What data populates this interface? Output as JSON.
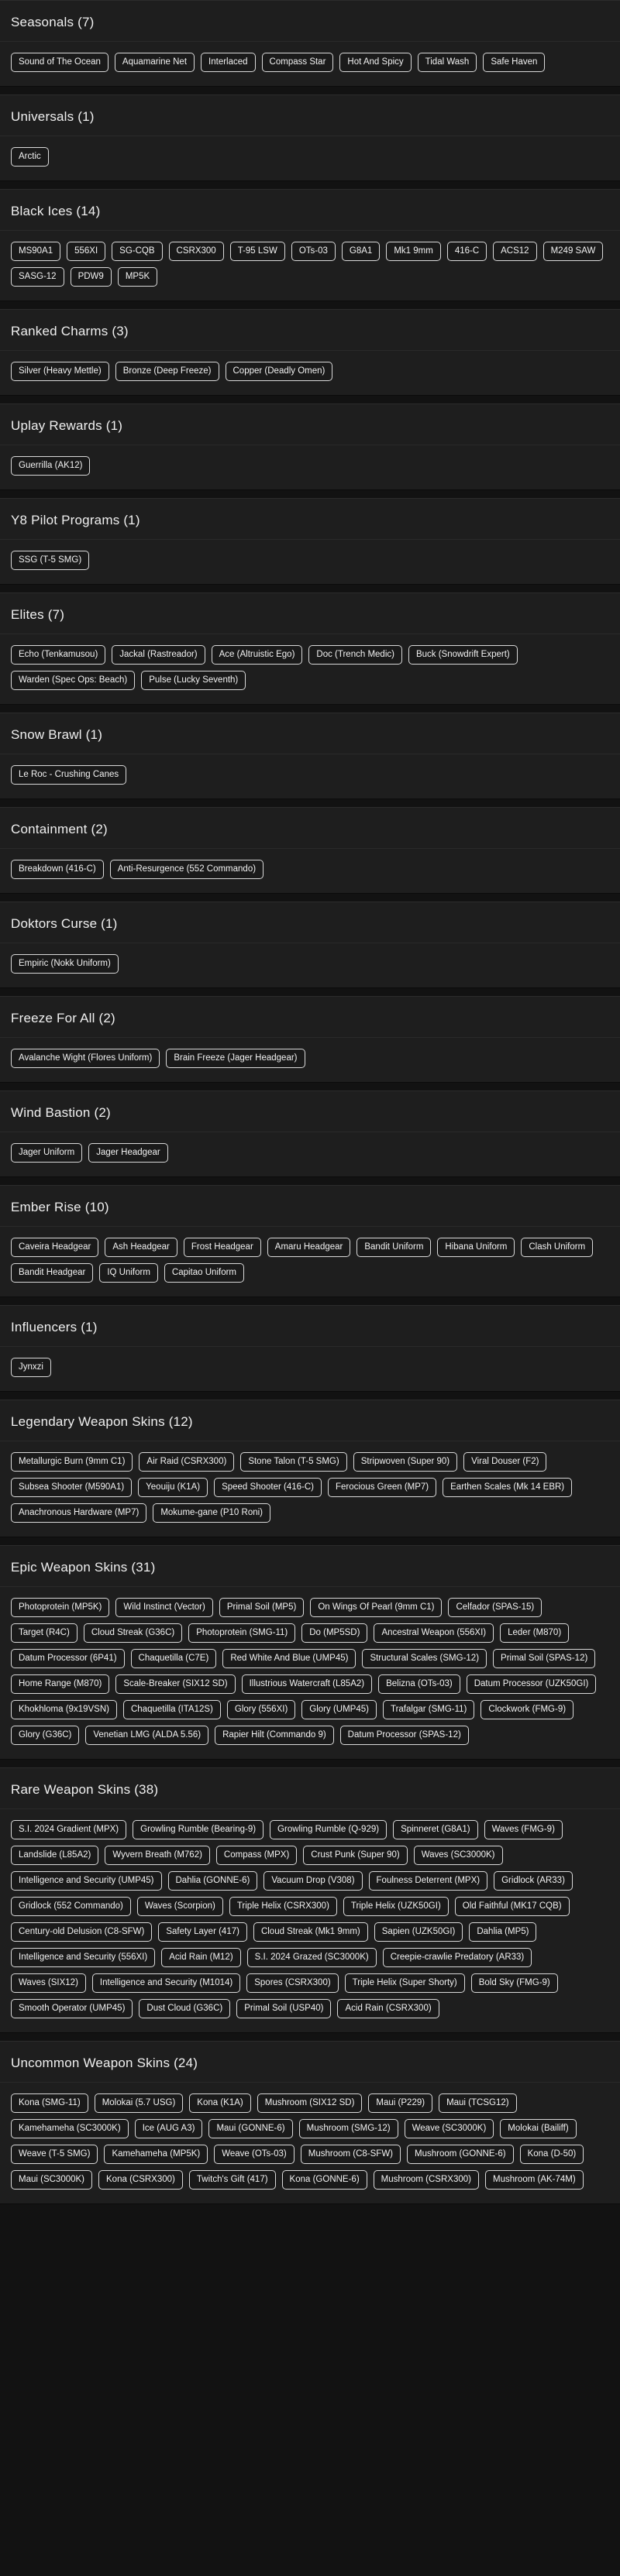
{
  "sections": [
    {
      "title": "Seasonals (7)",
      "items": [
        "Sound of The Ocean",
        "Aquamarine Net",
        "Interlaced",
        "Compass Star",
        "Hot And Spicy",
        "Tidal Wash",
        "Safe Haven"
      ]
    },
    {
      "title": "Universals (1)",
      "items": [
        "Arctic"
      ]
    },
    {
      "title": "Black Ices (14)",
      "items": [
        "MS90A1",
        "556XI",
        "SG-CQB",
        "CSRX300",
        "T-95 LSW",
        "OTs-03",
        "G8A1",
        "Mk1 9mm",
        "416-C",
        "ACS12",
        "M249 SAW",
        "SASG-12",
        "PDW9",
        "MP5K"
      ]
    },
    {
      "title": "Ranked Charms (3)",
      "items": [
        "Silver (Heavy Mettle)",
        "Bronze (Deep Freeze)",
        "Copper (Deadly Omen)"
      ]
    },
    {
      "title": "Uplay Rewards (1)",
      "items": [
        "Guerrilla (AK12)"
      ]
    },
    {
      "title": "Y8 Pilot Programs (1)",
      "items": [
        "SSG (T-5 SMG)"
      ]
    },
    {
      "title": "Elites (7)",
      "items": [
        "Echo (Tenkamusou)",
        "Jackal (Rastreador)",
        "Ace (Altruistic Ego)",
        "Doc (Trench Medic)",
        "Buck (Snowdrift Expert)",
        "Warden (Spec Ops: Beach)",
        "Pulse (Lucky Seventh)"
      ]
    },
    {
      "title": "Snow Brawl (1)",
      "items": [
        "Le Roc - Crushing Canes"
      ]
    },
    {
      "title": "Containment (2)",
      "items": [
        "Breakdown (416-C)",
        "Anti-Resurgence (552 Commando)"
      ]
    },
    {
      "title": "Doktors Curse (1)",
      "items": [
        "Empiric (Nokk Uniform)"
      ]
    },
    {
      "title": "Freeze For All (2)",
      "items": [
        "Avalanche Wight (Flores Uniform)",
        "Brain Freeze (Jager Headgear)"
      ]
    },
    {
      "title": "Wind Bastion (2)",
      "items": [
        "Jager Uniform",
        "Jager Headgear"
      ]
    },
    {
      "title": "Ember Rise (10)",
      "items": [
        "Caveira Headgear",
        "Ash Headgear",
        "Frost Headgear",
        "Amaru Headgear",
        "Bandit Uniform",
        "Hibana Uniform",
        "Clash Uniform",
        "Bandit Headgear",
        "IQ Uniform",
        "Capitao Uniform"
      ]
    },
    {
      "title": "Influencers (1)",
      "items": [
        "Jynxzi"
      ]
    },
    {
      "title": "Legendary Weapon Skins (12)",
      "items": [
        "Metallurgic Burn (9mm C1)",
        "Air Raid (CSRX300)",
        "Stone Talon (T-5 SMG)",
        "Stripwoven (Super 90)",
        "Viral Douser (F2)",
        "Subsea Shooter (M590A1)",
        "Yeouiju (K1A)",
        "Speed Shooter (416-C)",
        "Ferocious Green (MP7)",
        "Earthen Scales (Mk 14 EBR)",
        "Anachronous Hardware (MP7)",
        "Mokume-gane (P10 Roni)"
      ]
    },
    {
      "title": "Epic Weapon Skins (31)",
      "items": [
        "Photoprotein (MP5K)",
        "Wild Instinct (Vector)",
        "Primal Soil (MP5)",
        "On Wings Of Pearl (9mm C1)",
        "Celfador (SPAS-15)",
        "Target (R4C)",
        "Cloud Streak (G36C)",
        "Photoprotein (SMG-11)",
        "Do (MP5SD)",
        "Ancestral Weapon (556XI)",
        "Leder (M870)",
        "Datum Processor (6P41)",
        "Chaquetilla (C7E)",
        "Red White And Blue (UMP45)",
        "Structural Scales (SMG-12)",
        "Primal Soil (SPAS-12)",
        "Home Range (M870)",
        "Scale-Breaker (SIX12 SD)",
        "Illustrious Watercraft (L85A2)",
        "Belizna (OTs-03)",
        "Datum Processor (UZK50GI)",
        "Khokhloma (9x19VSN)",
        "Chaquetilla (ITA12S)",
        "Glory (556XI)",
        "Glory (UMP45)",
        "Trafalgar (SMG-11)",
        "Clockwork (FMG-9)",
        "Glory (G36C)",
        "Venetian LMG (ALDA 5.56)",
        "Rapier Hilt (Commando 9)",
        "Datum Processor (SPAS-12)"
      ]
    },
    {
      "title": "Rare Weapon Skins (38)",
      "items": [
        "S.I. 2024 Gradient (MPX)",
        "Growling Rumble (Bearing-9)",
        "Growling Rumble (Q-929)",
        "Spinneret (G8A1)",
        "Waves (FMG-9)",
        "Landslide (L85A2)",
        "Wyvern Breath (M762)",
        "Compass (MPX)",
        "Crust Punk (Super 90)",
        "Waves (SC3000K)",
        "Intelligence and Security (UMP45)",
        "Dahlia (GONNE-6)",
        "Vacuum Drop (V308)",
        "Foulness Deterrent (MPX)",
        "Gridlock (AR33)",
        "Gridlock (552 Commando)",
        "Waves (Scorpion)",
        "Triple Helix (CSRX300)",
        "Triple Helix (UZK50GI)",
        "Old Faithful (MK17 CQB)",
        "Century-old Delusion (C8-SFW)",
        "Safety Layer (417)",
        "Cloud Streak (Mk1 9mm)",
        "Sapien (UZK50GI)",
        "Dahlia (MP5)",
        "Intelligence and Security (556XI)",
        "Acid Rain (M12)",
        "S.I. 2024 Grazed (SC3000K)",
        "Creepie-crawlie Predatory (AR33)",
        "Waves (SIX12)",
        "Intelligence and Security (M1014)",
        "Spores (CSRX300)",
        "Triple Helix (Super Shorty)",
        "Bold Sky (FMG-9)",
        "Smooth Operator (UMP45)",
        "Dust Cloud (G36C)",
        "Primal Soil (USP40)",
        "Acid Rain (CSRX300)"
      ]
    },
    {
      "title": "Uncommon Weapon Skins (24)",
      "items": [
        "Kona (SMG-11)",
        "Molokai (5.7 USG)",
        "Kona (K1A)",
        "Mushroom (SIX12 SD)",
        "Maui (P229)",
        "Maui (TCSG12)",
        "Kamehameha (SC3000K)",
        "Ice (AUG A3)",
        "Maui (GONNE-6)",
        "Mushroom (SMG-12)",
        "Weave (SC3000K)",
        "Molokai (Bailiff)",
        "Weave (T-5 SMG)",
        "Kamehameha (MP5K)",
        "Weave (OTs-03)",
        "Mushroom (C8-SFW)",
        "Mushroom (GONNE-6)",
        "Kona (D-50)",
        "Maui (SC3000K)",
        "Kona (CSRX300)",
        "Twitch's Gift (417)",
        "Kona (GONNE-6)",
        "Mushroom (CSRX300)",
        "Mushroom (AK-74M)"
      ]
    }
  ]
}
